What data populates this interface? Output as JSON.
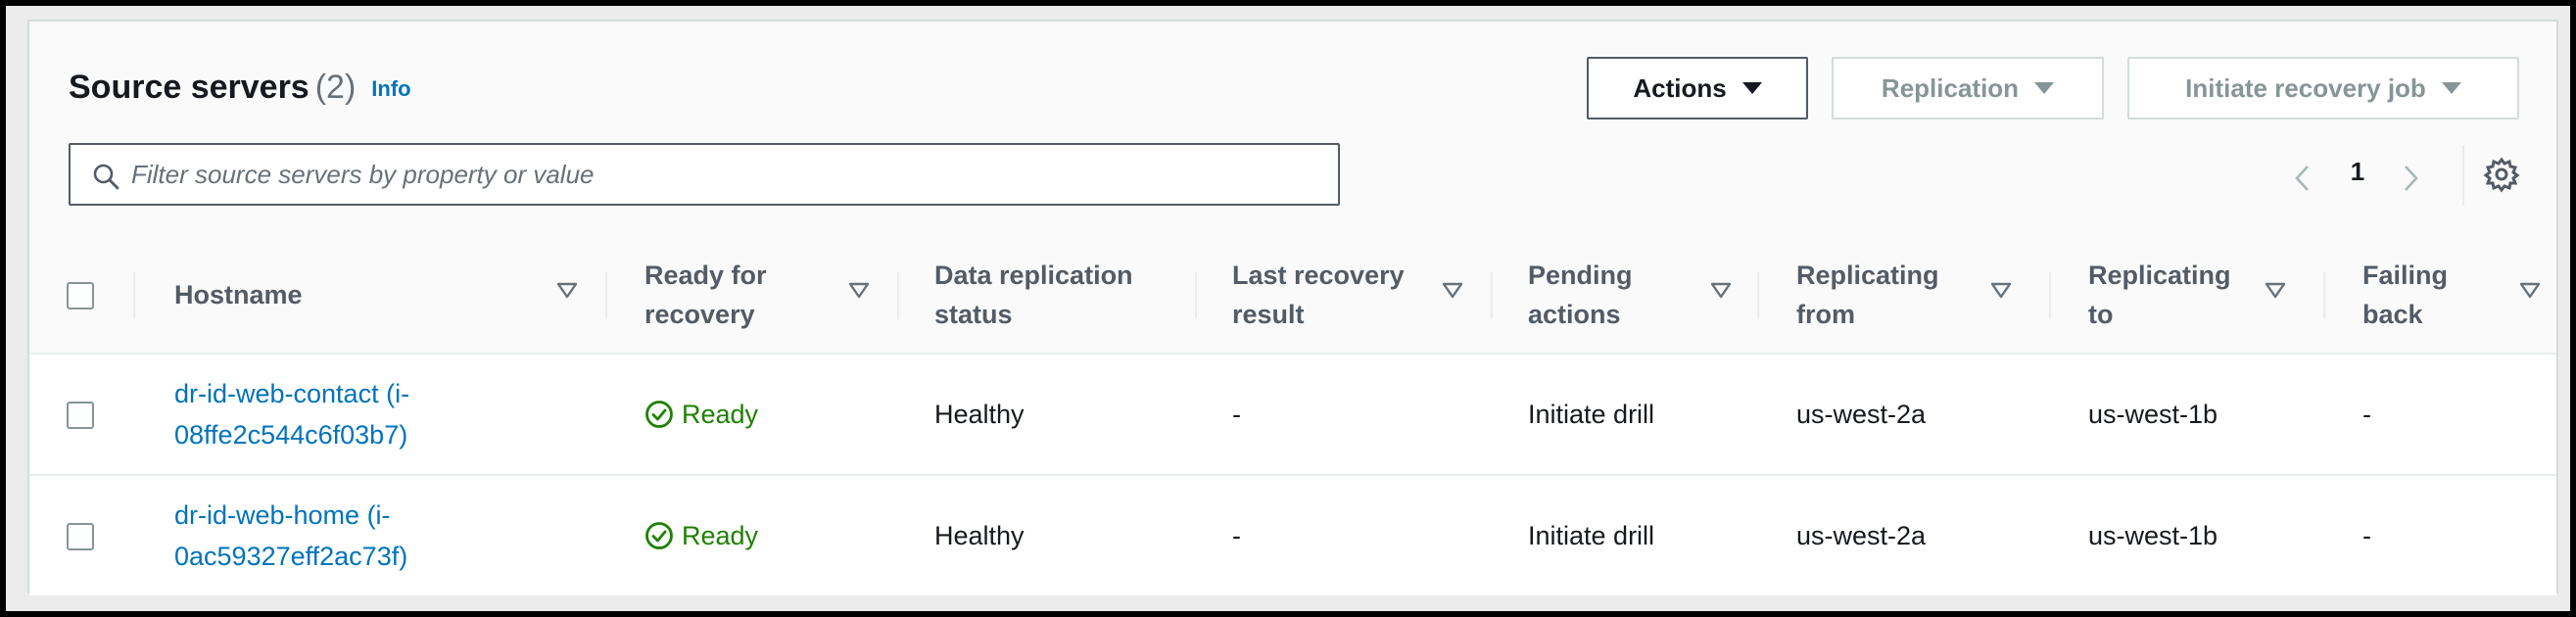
{
  "header": {
    "title": "Source servers",
    "count": "(2)",
    "info_link": "Info"
  },
  "toolbar": {
    "actions_label": "Actions",
    "replication_label": "Replication",
    "initiate_recovery_label": "Initiate recovery job"
  },
  "search": {
    "placeholder": "Filter source servers by property or value",
    "value": ""
  },
  "pagination": {
    "current_page": "1"
  },
  "table": {
    "columns": [
      {
        "label": "Hostname"
      },
      {
        "label": "Ready for\nrecovery"
      },
      {
        "label": "Data replication\nstatus"
      },
      {
        "label": "Last recovery\nresult"
      },
      {
        "label": "Pending\nactions"
      },
      {
        "label": "Replicating\nfrom"
      },
      {
        "label": "Replicating\nto"
      },
      {
        "label": "Failing\nback"
      }
    ],
    "rows": [
      {
        "hostname": "dr-id-web-contact (i-08ffe2c544c6f03b7)",
        "ready": "Ready",
        "replication_status": "Healthy",
        "last_recovery": "-",
        "pending_actions": "Initiate drill",
        "replicating_from": "us-west-2a",
        "replicating_to": "us-west-1b",
        "failing_back": "-"
      },
      {
        "hostname": "dr-id-web-home (i-0ac59327eff2ac73f)",
        "ready": "Ready",
        "replication_status": "Healthy",
        "last_recovery": "-",
        "pending_actions": "Initiate drill",
        "replicating_from": "us-west-2a",
        "replicating_to": "us-west-1b",
        "failing_back": "-"
      }
    ]
  },
  "icons": {
    "search": "search-icon",
    "prev": "chevron-left-icon",
    "next": "chevron-right-icon",
    "settings": "gear-icon",
    "sort": "sort-caret-icon",
    "ready": "check-circle-icon"
  },
  "colors": {
    "link": "#0073bb",
    "success": "#1d8102",
    "border_dark": "#545b64",
    "border_light": "#d5dbdb"
  }
}
